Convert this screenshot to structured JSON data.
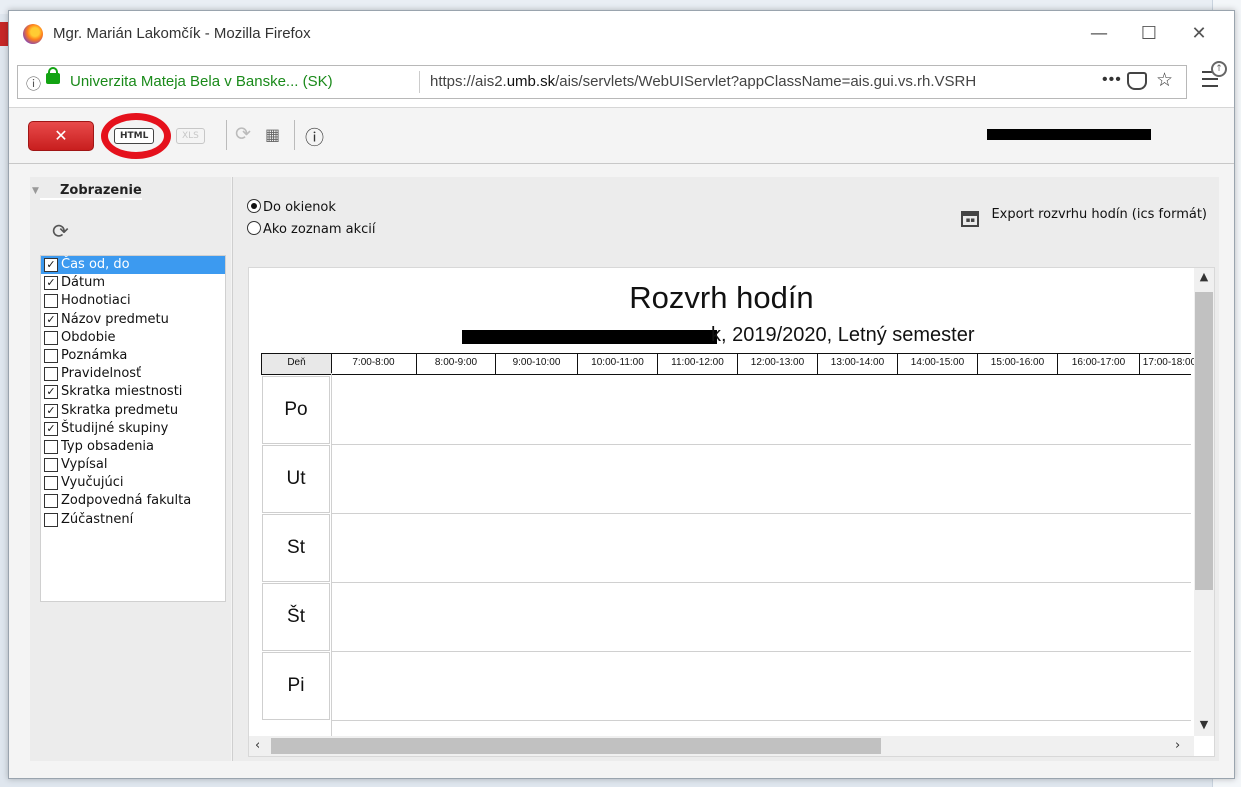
{
  "window": {
    "title": "Mgr. Marián Lakomčík - Mozilla Firefox",
    "minimize": "—",
    "maximize": "☐",
    "close": "✕"
  },
  "urlbar": {
    "site_identity": "Univerzita Mateja Bela v Banske... (SK)",
    "url_prefix": "https://ais2.",
    "url_domain": "umb.sk",
    "url_rest": "/ais/servlets/WebUIServlet?appClassName=ais.gui.vs.rh.VSRH",
    "more": "•••"
  },
  "toolbar": {
    "close_label": "✕",
    "html_label": "HTML",
    "xls_label": "XLS",
    "user_name_redacted": "redacted user name"
  },
  "left_panel": {
    "section_title": "Zobrazenie",
    "items": [
      {
        "label": "Čas od, do",
        "checked": true,
        "selected": true
      },
      {
        "label": "Dátum",
        "checked": true,
        "selected": false
      },
      {
        "label": "Hodnotiaci",
        "checked": false,
        "selected": false
      },
      {
        "label": "Názov predmetu",
        "checked": true,
        "selected": false
      },
      {
        "label": "Obdobie",
        "checked": false,
        "selected": false
      },
      {
        "label": "Poznámka",
        "checked": false,
        "selected": false
      },
      {
        "label": "Pravidelnosť",
        "checked": false,
        "selected": false
      },
      {
        "label": "Skratka miestnosti",
        "checked": true,
        "selected": false
      },
      {
        "label": "Skratka predmetu",
        "checked": true,
        "selected": false
      },
      {
        "label": "Študijné skupiny",
        "checked": true,
        "selected": false
      },
      {
        "label": "Typ obsadenia",
        "checked": false,
        "selected": false
      },
      {
        "label": "Vypísal",
        "checked": false,
        "selected": false
      },
      {
        "label": "Vyučujúci",
        "checked": false,
        "selected": false
      },
      {
        "label": "Zodpovedná fakulta",
        "checked": false,
        "selected": false
      },
      {
        "label": "Zúčastnení",
        "checked": false,
        "selected": false
      }
    ]
  },
  "main": {
    "radio_grid": "Do okienok",
    "radio_list": "Ako zoznam akcií",
    "export_label": "Export rozvrhu hodín (ics formát)",
    "schedule": {
      "title": "Rozvrh hodín",
      "subtitle_tail": "k, 2019/2020, Letný semester",
      "day_header": "Deň",
      "time_slots": [
        "7:00-8:00",
        "8:00-9:00",
        "9:00-10:00",
        "10:00-11:00",
        "11:00-12:00",
        "12:00-13:00",
        "13:00-14:00",
        "14:00-15:00",
        "15:00-16:00",
        "16:00-17:00",
        "17:00-18:00"
      ],
      "days": [
        "Po",
        "Ut",
        "St",
        "Št",
        "Pi"
      ]
    }
  }
}
